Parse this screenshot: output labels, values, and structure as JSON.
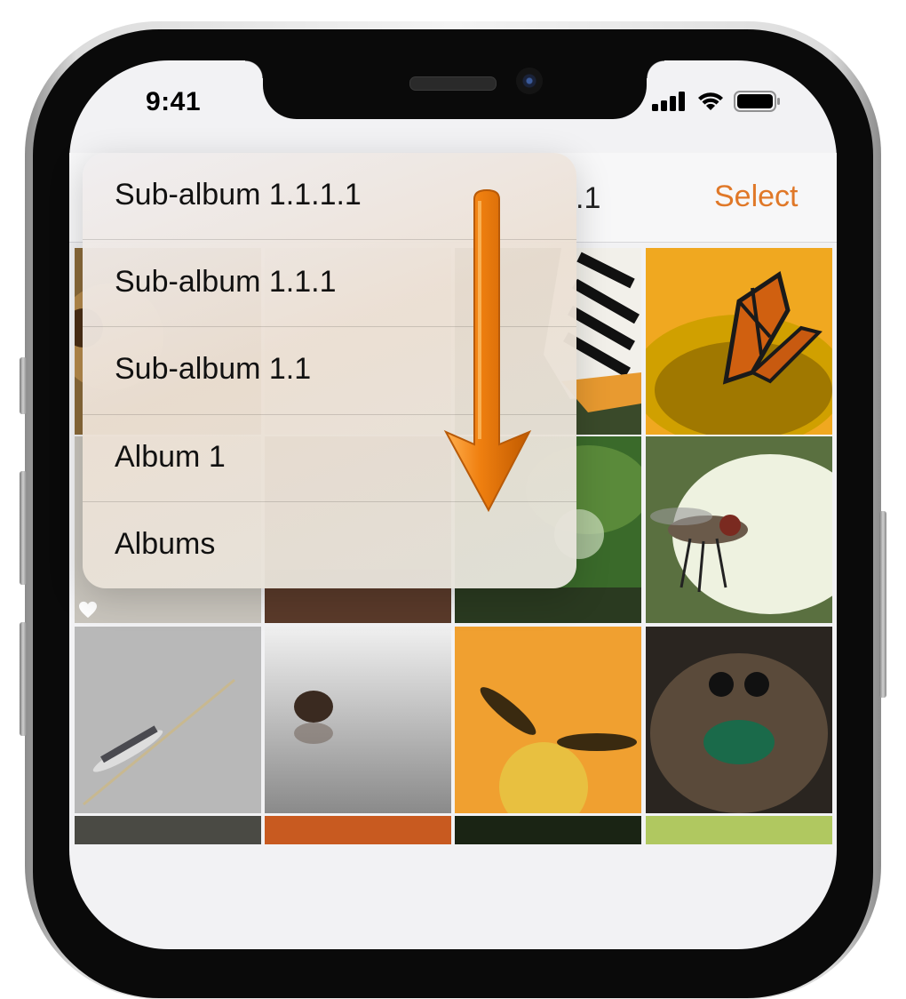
{
  "status_bar": {
    "time": "9:41"
  },
  "nav": {
    "title_fragment": ".1",
    "select_label": "Select"
  },
  "menu": {
    "items": [
      {
        "label": "Sub-album 1.1.1.1"
      },
      {
        "label": "Sub-album 1.1.1"
      },
      {
        "label": "Sub-album 1.1"
      },
      {
        "label": "Album 1"
      },
      {
        "label": "Albums"
      }
    ]
  },
  "grid": {
    "photos": [
      "partial-photo",
      "partial-photo",
      "swallowtail-butterfly",
      "monarch-butterfly-on-sunflower",
      "partial-photo",
      "partial-photo",
      "leaf-photo",
      "fly-on-light-background",
      "dragonfly-on-stem",
      "jumping-spider-reflection",
      "hoverflies-on-orange-flower",
      "jumping-spider-closeup",
      "partial-photo",
      "orange-photo",
      "dark-photo",
      "green-photo"
    ],
    "favorite_icon": "heart-icon"
  },
  "colors": {
    "accent": "#e07828",
    "arrow": "#f07d10"
  }
}
